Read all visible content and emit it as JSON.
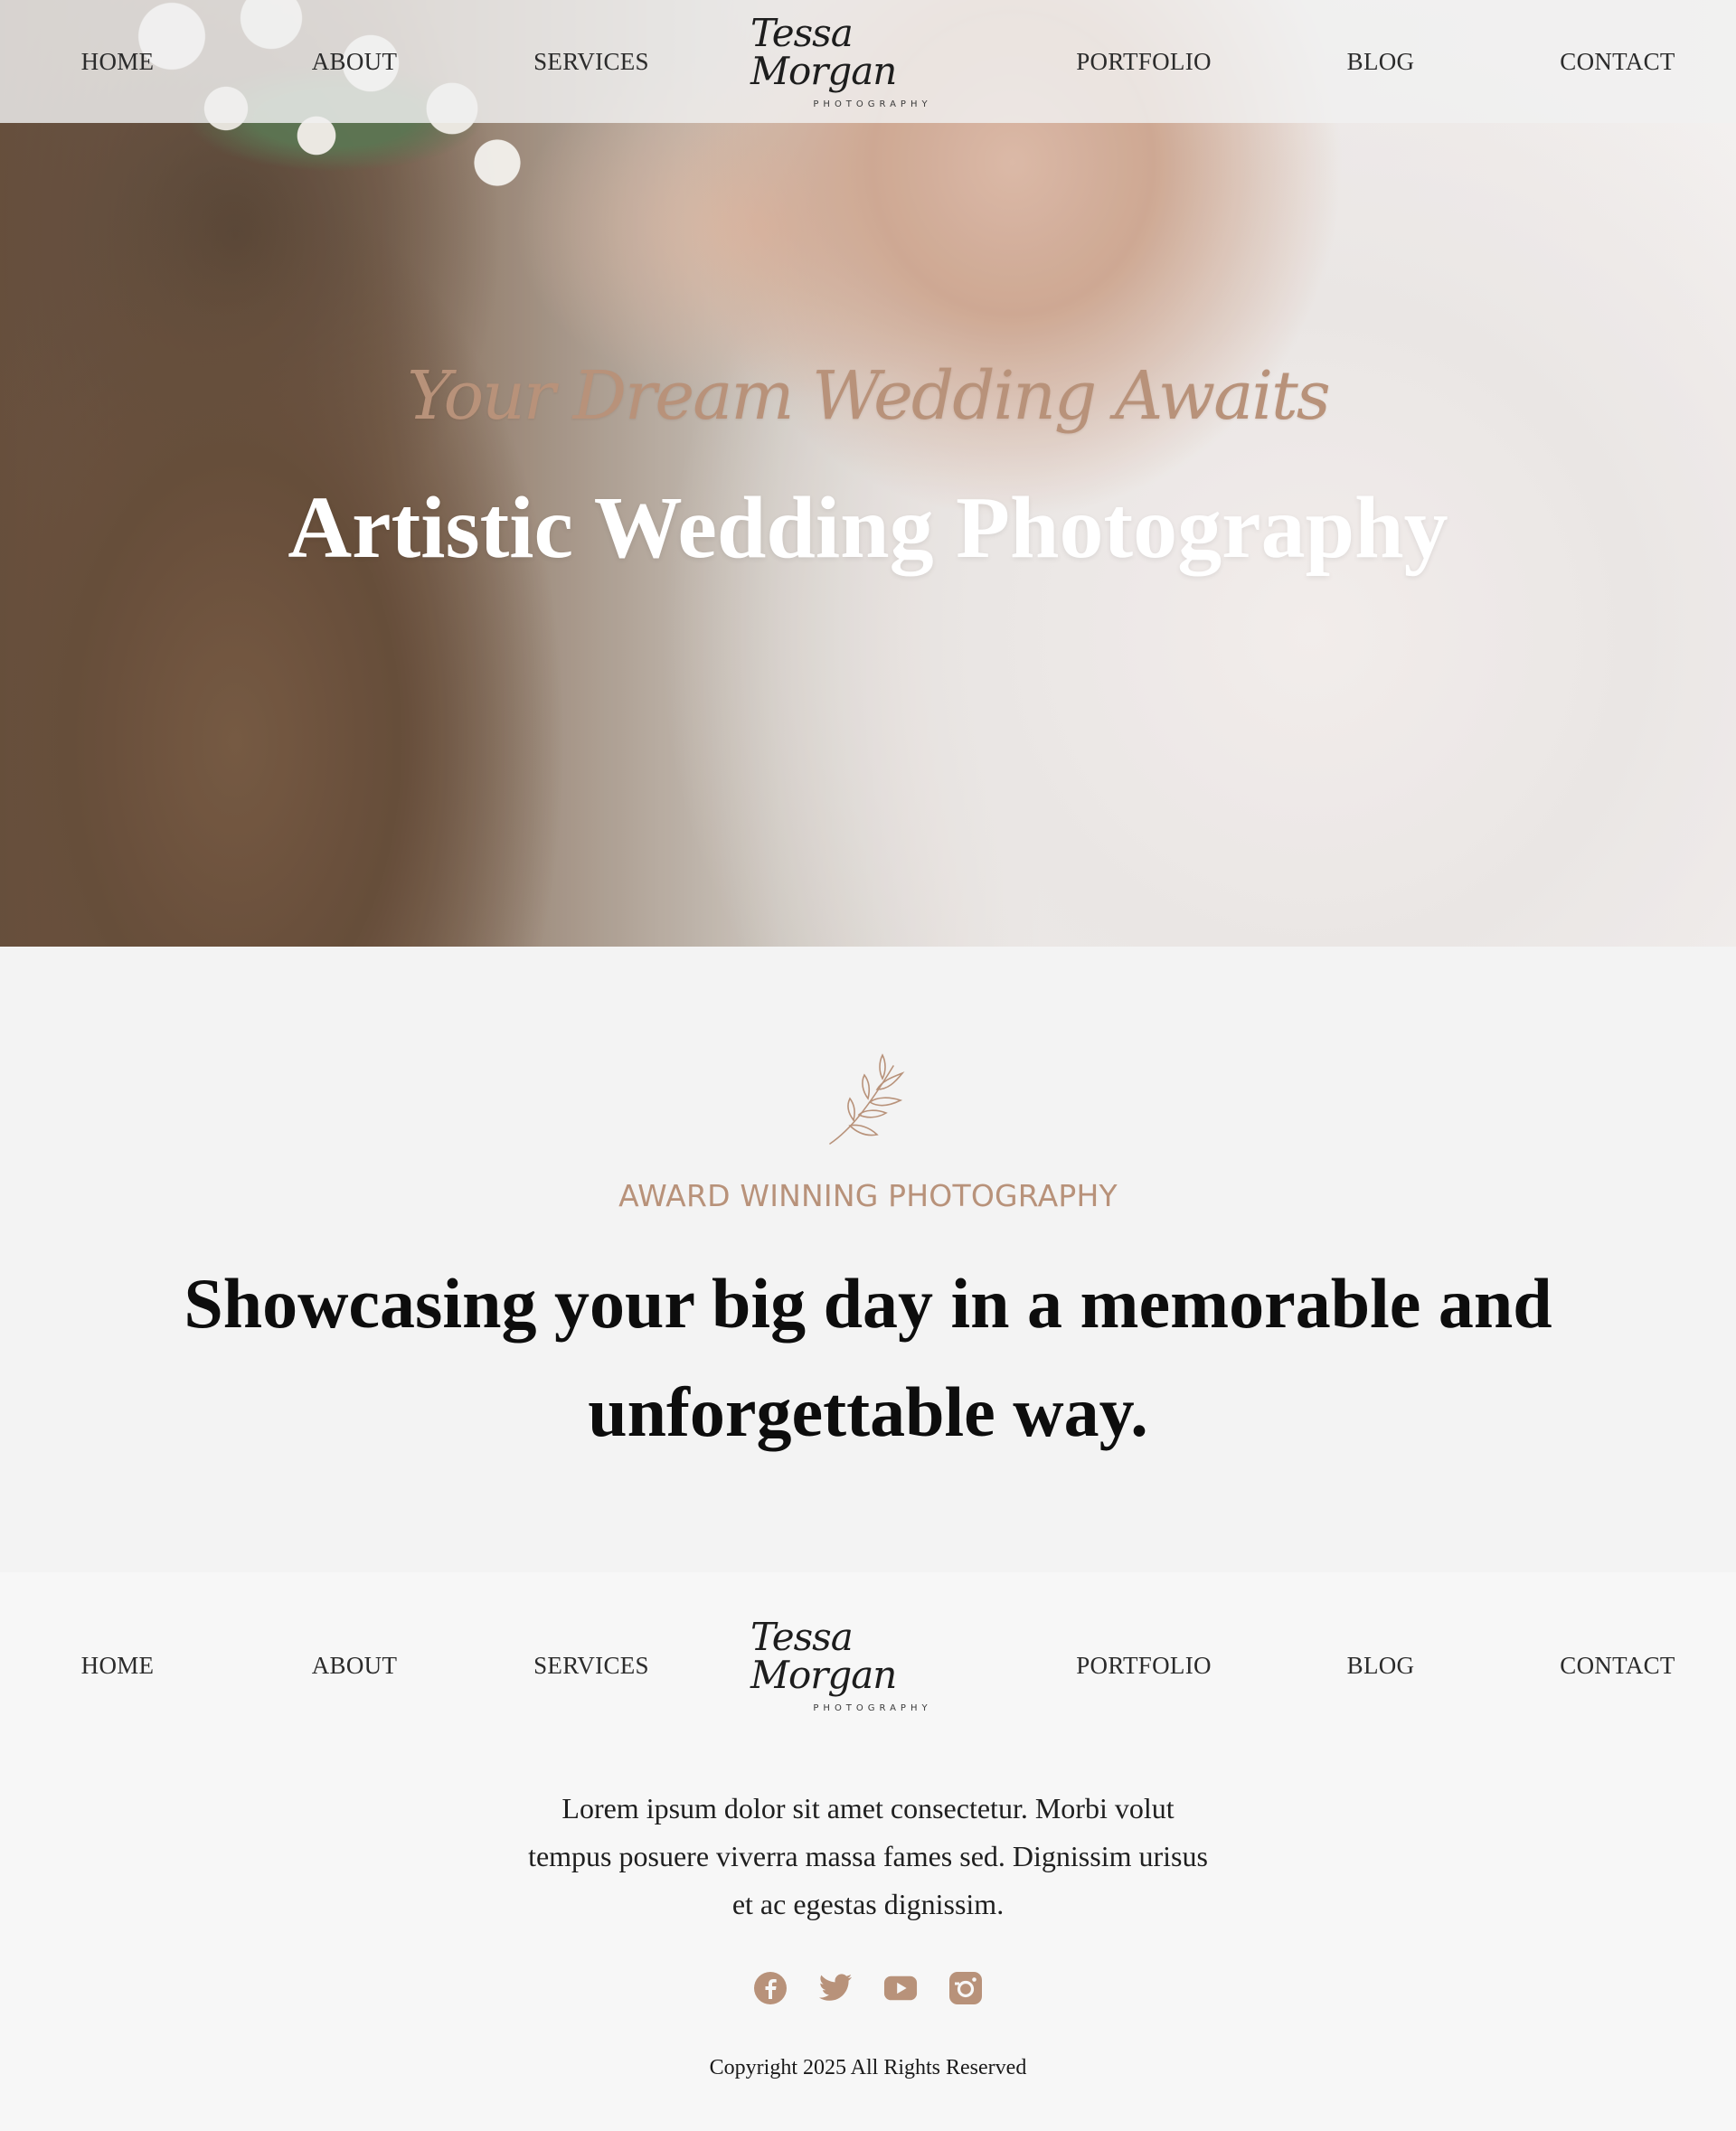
{
  "brand": {
    "logo_script": "Tessa Morgan",
    "logo_sub": "PHOTOGRAPHY",
    "accent_color": "#b8927a"
  },
  "nav": {
    "items": [
      "HOME",
      "ABOUT",
      "SERVICES",
      "PORTFOLIO",
      "BLOG",
      "CONTACT"
    ]
  },
  "hero": {
    "subtitle": "Your Dream Wedding Awaits",
    "title": "Artistic Wedding Photography"
  },
  "about": {
    "icon": "leaf-sprig-icon",
    "eyebrow": "AWARD WINNING PHOTOGRAPHY",
    "headline": "Showcasing your big day in a memorable and unforgettable way."
  },
  "footer": {
    "text": "Lorem ipsum dolor sit amet consectetur. Morbi volut tempus posuere viverra massa fames sed. Dignissim urisus et ac egestas dignissim.",
    "socials": [
      "facebook-icon",
      "twitter-icon",
      "youtube-icon",
      "instagram-icon"
    ],
    "copyright": "Copyright 2025 All Rights Reserved"
  }
}
